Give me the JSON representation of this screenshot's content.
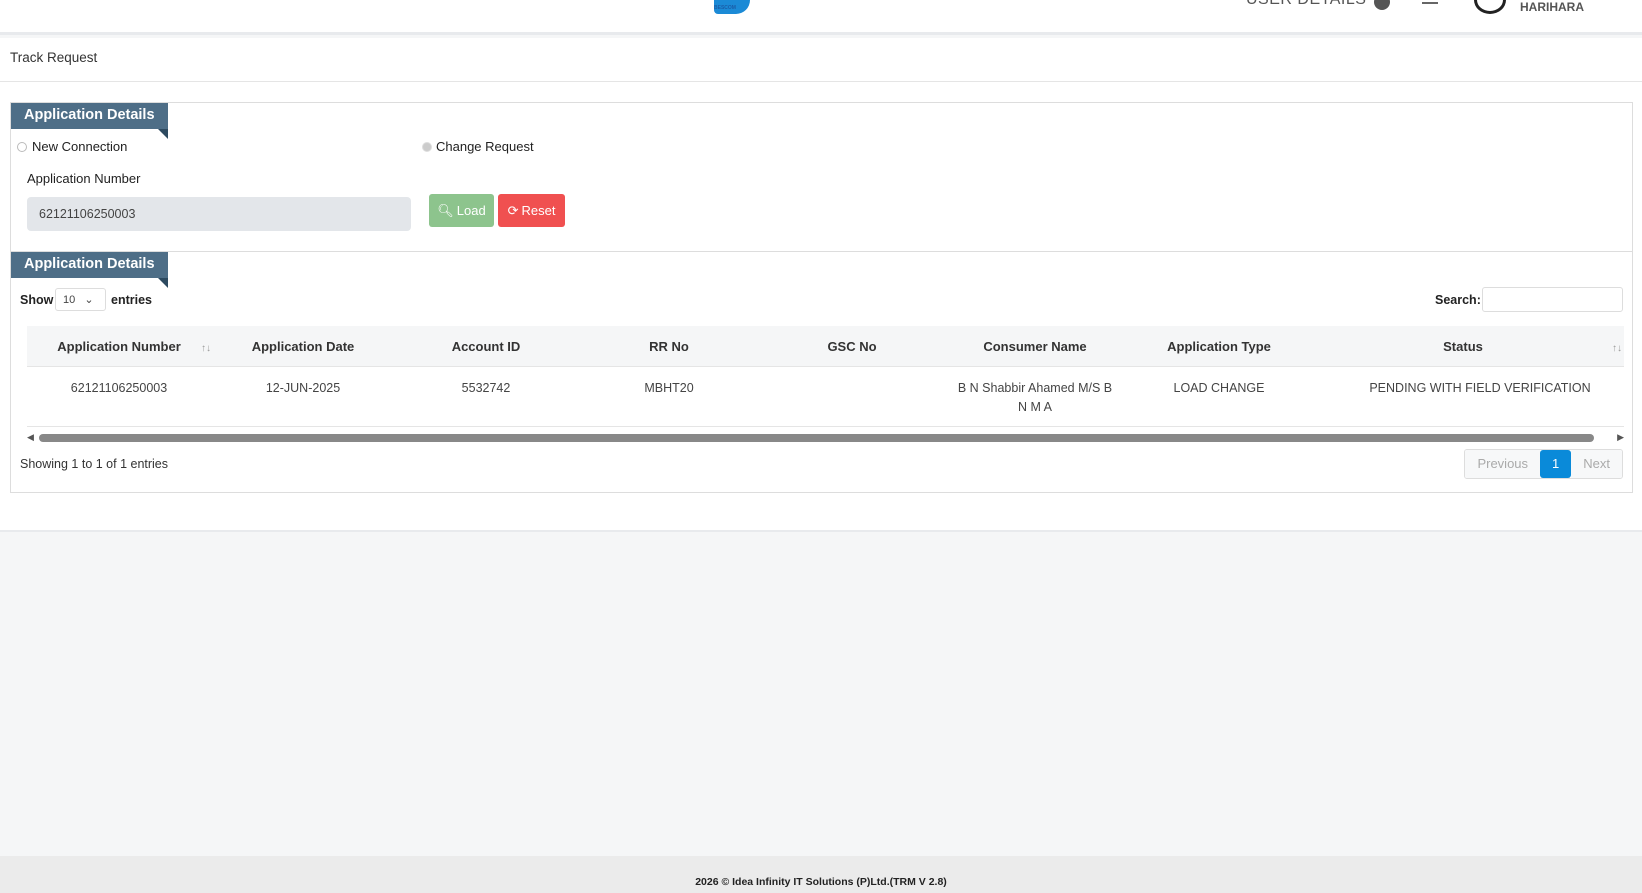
{
  "header": {
    "logo_text": "BESCOM",
    "user_details_label": "USER DETAILS",
    "username": "HARIHARA"
  },
  "page_title": "Track Request",
  "search_panel": {
    "title": "Application Details",
    "radio_new": "New Connection",
    "radio_change": "Change Request",
    "selected": "Change Request",
    "app_number_label": "Application Number",
    "app_number_value": "62121106250003",
    "load_label": "Load",
    "reset_label": "Reset"
  },
  "results_panel": {
    "title": "Application Details",
    "show_label": "Show",
    "entries_value": "10",
    "entries_label": "entries",
    "search_label": "Search:",
    "columns": [
      "Application Number",
      "Application Date",
      "Account ID",
      "RR No",
      "GSC No",
      "Consumer Name",
      "Application Type",
      "Status"
    ],
    "rows": [
      [
        "62121106250003",
        "12-JUN-2025",
        "5532742",
        "MBHT20",
        "",
        "B N Shabbir Ahamed M/S B N M A",
        "LOAD CHANGE",
        "PENDING WITH FIELD VERIFICATION"
      ]
    ],
    "info": "Showing 1 to 1 of 1 entries",
    "prev": "Previous",
    "page": "1",
    "next": "Next"
  },
  "footer": "2026 © Idea Infinity IT Solutions (P)Ltd.(TRM V 2.8)",
  "colors": {
    "tab": "#4e6e87",
    "load": "#8dc48d",
    "reset": "#f05050",
    "page_active": "#0a8ad9"
  }
}
